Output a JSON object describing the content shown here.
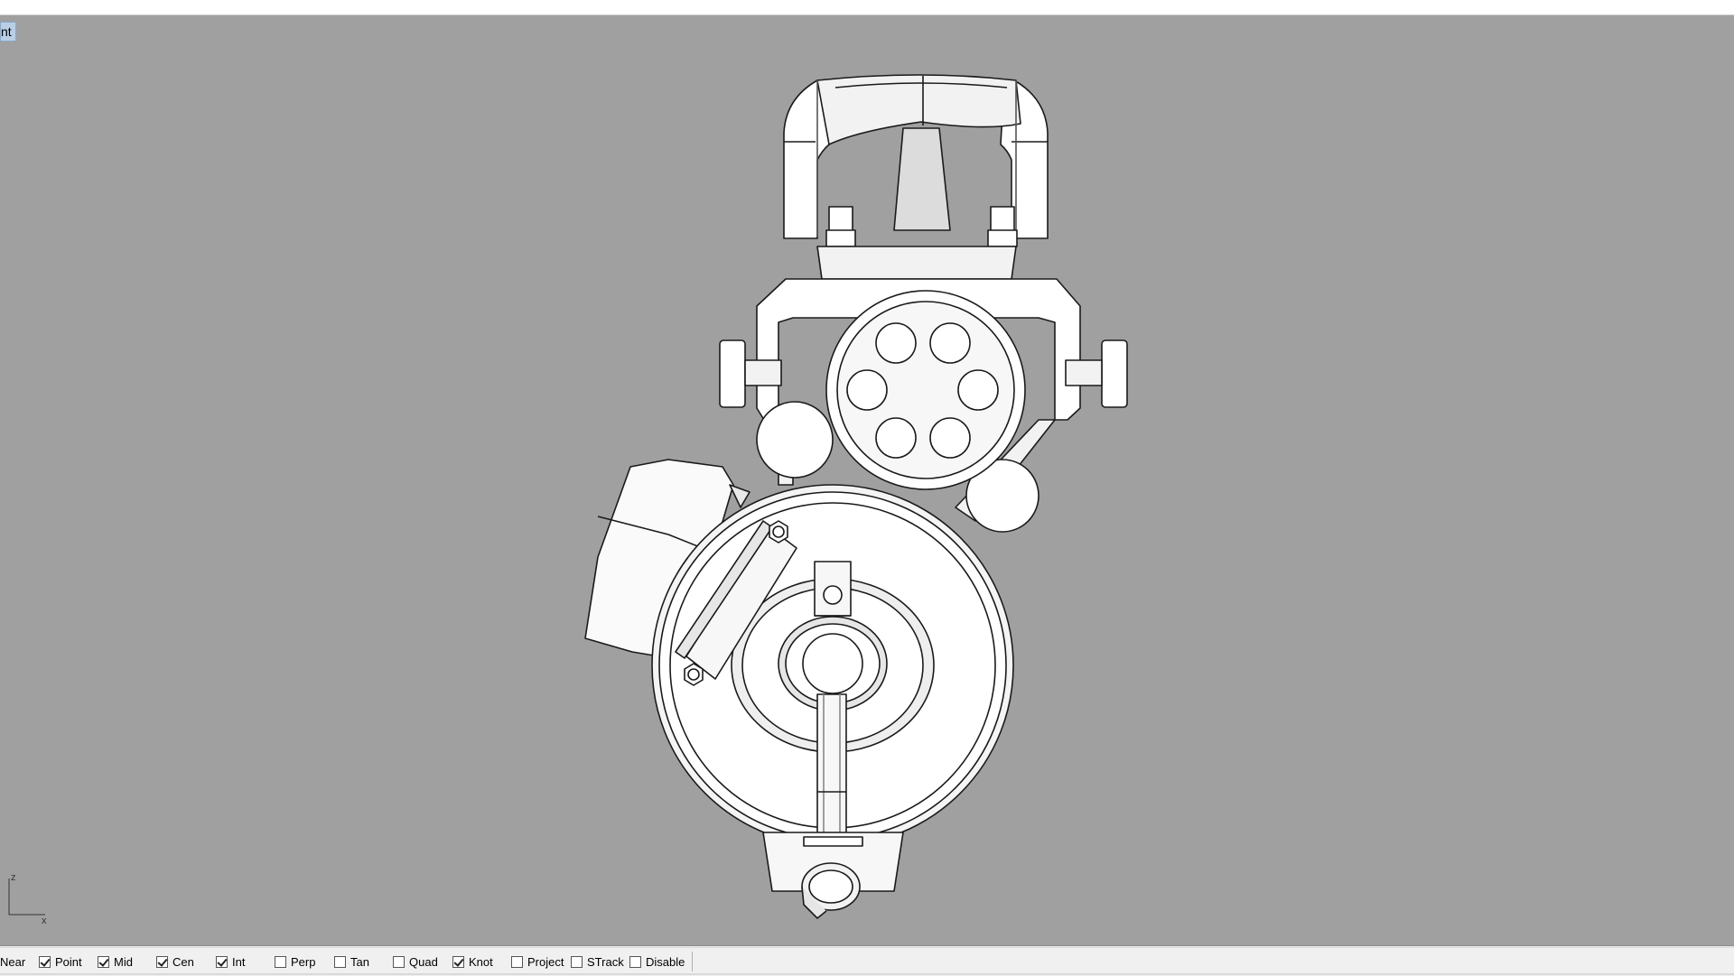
{
  "viewport": {
    "title_visible_fragment": "nt",
    "axis": {
      "z_label": "z",
      "x_label": "x"
    }
  },
  "statusbar": {
    "osnaps": [
      {
        "label": "Near",
        "checked": true,
        "checkbox_visible": false
      },
      {
        "label": "Point",
        "checked": true
      },
      {
        "label": "Mid",
        "checked": true
      },
      {
        "label": "Cen",
        "checked": true
      },
      {
        "label": "Int",
        "checked": true
      },
      {
        "label": "Perp",
        "checked": false
      },
      {
        "label": "Tan",
        "checked": false
      },
      {
        "label": "Quad",
        "checked": false
      },
      {
        "label": "Knot",
        "checked": true
      },
      {
        "label": "Project",
        "checked": false
      },
      {
        "label": "STrack",
        "checked": false
      },
      {
        "label": "Disable",
        "checked": false
      }
    ]
  },
  "colors": {
    "viewport_background": "#a0a0a0",
    "title_highlight": "#b8cfe6",
    "statusbar_background": "#f0f0f0",
    "model_fill": "#ffffff",
    "model_stroke": "#1a1a1a",
    "model_shade": "#dcdcdc"
  }
}
